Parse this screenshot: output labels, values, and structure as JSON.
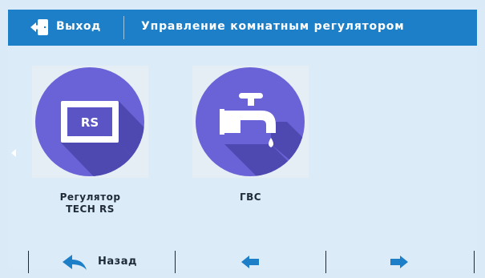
{
  "header": {
    "exit_label": "Выход",
    "title": "Управление комнатным регулятором"
  },
  "tiles": [
    {
      "label": "Регулятор\nTECH RS",
      "icon_text": "RS",
      "icon": "rs-controller-icon"
    },
    {
      "label": "ГВС",
      "icon": "water-tap-icon"
    }
  ],
  "footer": {
    "back_label": "Назад",
    "prev_icon": "arrow-left-icon",
    "next_icon": "arrow-right-icon"
  },
  "colors": {
    "header_bg": "#1d7fc7",
    "page_bg": "#dcebf8",
    "icon_circle": "#6a63d8",
    "icon_shadow": "#4e49b0",
    "nav_blue": "#1d7fc7",
    "text_dark": "#1e2a38"
  }
}
